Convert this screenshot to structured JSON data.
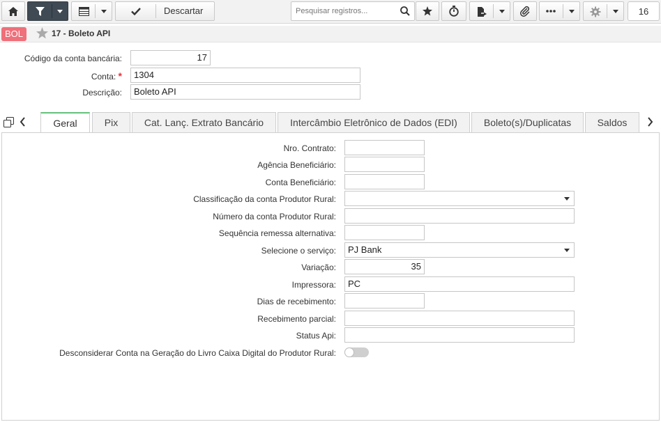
{
  "toolbar": {
    "discard_label": "Descartar",
    "search_placeholder": "Pesquisar registros...",
    "page_count": "16"
  },
  "title_bar": {
    "badge": "BOL",
    "title": "17 - Boleto API"
  },
  "header": {
    "codigo_label": "Código da conta bancária:",
    "codigo_value": "17",
    "conta_label": "Conta:",
    "conta_required": "*",
    "conta_value": "1304",
    "descricao_label": "Descrição:",
    "descricao_value": "Boleto API"
  },
  "tabs": [
    {
      "label": "Geral",
      "active": true
    },
    {
      "label": "Pix"
    },
    {
      "label": "Cat. Lanç. Extrato Bancário"
    },
    {
      "label": "Intercâmbio Eletrônico de Dados (EDI)"
    },
    {
      "label": "Boleto(s)/Duplicatas"
    },
    {
      "label": "Saldos"
    }
  ],
  "form": {
    "nro_contrato": {
      "label": "Nro. Contrato:",
      "value": ""
    },
    "agencia": {
      "label": "Agência Beneficiário:",
      "value": ""
    },
    "conta_benef": {
      "label": "Conta Beneficiário:",
      "value": ""
    },
    "classificacao": {
      "label": "Classificação da conta Produtor Rural:",
      "value": ""
    },
    "numero_conta_rural": {
      "label": "Número da conta Produtor Rural:",
      "value": ""
    },
    "sequencia": {
      "label": "Sequência remessa alternativa:",
      "value": ""
    },
    "servico": {
      "label": "Selecione o serviço:",
      "value": "PJ Bank"
    },
    "variacao": {
      "label": "Variação:",
      "value": "35"
    },
    "impressora": {
      "label": "Impressora:",
      "value": "PC"
    },
    "dias_recebimento": {
      "label": "Dias de recebimento:",
      "value": ""
    },
    "recebimento_parcial": {
      "label": "Recebimento parcial:",
      "value": ""
    },
    "status_api": {
      "label": "Status Api:",
      "value": ""
    },
    "desconsiderar": {
      "label": "Desconsiderar Conta na Geração do Livro Caixa Digital do Produtor Rural:",
      "on": false
    }
  },
  "colors": {
    "accent_tab": "#64c27a",
    "badge": "#ef6f7a",
    "toolbar_dark": "#3f4a55",
    "required": "#e0353b"
  },
  "icons": [
    "home-icon",
    "filter-icon",
    "grid-icon",
    "check-icon",
    "search-icon",
    "star-icon",
    "stopwatch-icon",
    "report-icon",
    "paperclip-icon",
    "more-icon",
    "gear-icon",
    "copy-icon",
    "chevron-left-icon",
    "chevron-right-icon"
  ]
}
